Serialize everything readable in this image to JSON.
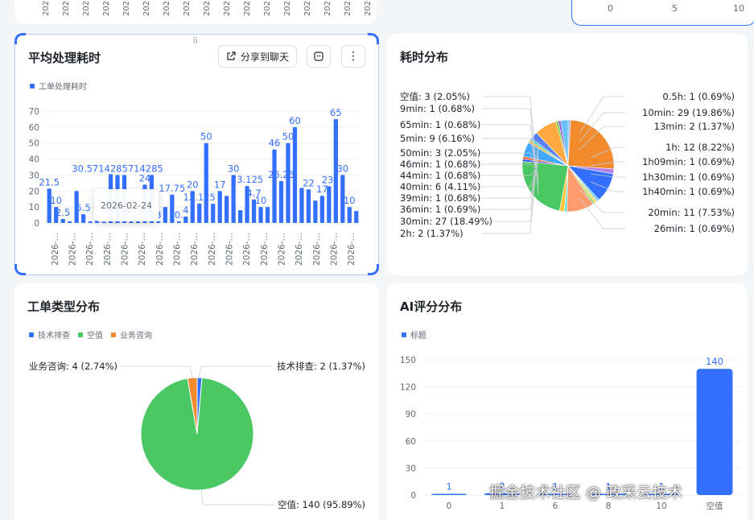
{
  "top_strip": {
    "ticks_right": [
      "0",
      "5",
      "10"
    ]
  },
  "avg_time": {
    "title": "平均处理耗时",
    "share_label": "分享到聊天",
    "tooltip": "2026-02-24",
    "chart_data": {
      "type": "bar",
      "series": [
        {
          "name": "工单处理耗时",
          "values": [
            21.5,
            10,
            2.5,
            1,
            20,
            5.5,
            1,
            1.5,
            0.8,
            30.5714285714285,
            30,
            30,
            1,
            1,
            24,
            30,
            1,
            10,
            17.75,
            1,
            4,
            20,
            12.125,
            50,
            12,
            20,
            17,
            30,
            8,
            23.125,
            14.7,
            10,
            10,
            46,
            26.25,
            50,
            60,
            22,
            21,
            14,
            17,
            23,
            65,
            30,
            10,
            7.5
          ]
        }
      ],
      "categories": [
        "2026-…",
        "2026-…",
        "2026-…",
        "2026-…",
        "2026-…",
        "2026-…",
        "2026-…",
        "2026-…",
        "2026-…",
        "2026-…",
        "2026-…",
        "2026-…",
        "2026-…",
        "2026-…",
        "2026-…",
        "2026-…",
        "2026-…",
        "2026-…"
      ],
      "data_labels": [
        {
          "i": 0,
          "text": "21.5"
        },
        {
          "i": 1,
          "text": "10"
        },
        {
          "i": 2,
          "text": "2.5"
        },
        {
          "i": 5,
          "text": "5.5"
        },
        {
          "i": 10,
          "text": "30.5714285714285"
        },
        {
          "i": 13,
          "text": "71428573"
        },
        {
          "i": 14,
          "text": "24"
        },
        {
          "i": 18,
          "text": "17.75"
        },
        {
          "i": 19,
          "text": "0."
        },
        {
          "i": 20,
          "text": "4"
        },
        {
          "i": 21,
          "text": "20"
        },
        {
          "i": 22,
          "text": "12.125"
        },
        {
          "i": 23,
          "text": "50"
        },
        {
          "i": 25,
          "text": "17"
        },
        {
          "i": 27,
          "text": "30"
        },
        {
          "i": 29,
          "text": "23.125"
        },
        {
          "i": 30,
          "text": "4.7"
        },
        {
          "i": 31,
          "text": "10"
        },
        {
          "i": 33,
          "text": "46"
        },
        {
          "i": 34,
          "text": "26.25"
        },
        {
          "i": 35,
          "text": "50"
        },
        {
          "i": 36,
          "text": "60"
        },
        {
          "i": 38,
          "text": "22"
        },
        {
          "i": 40,
          "text": "17"
        },
        {
          "i": 41,
          "text": "23."
        },
        {
          "i": 42,
          "text": "65"
        },
        {
          "i": 43,
          "text": "30"
        },
        {
          "i": 44,
          "text": "10"
        }
      ],
      "ylim": [
        0,
        70
      ],
      "yticks": [
        0,
        10,
        20,
        30,
        40,
        50,
        60,
        70
      ],
      "grid": true,
      "legend_position": "top-left",
      "color": "#3370ff"
    }
  },
  "time_dist": {
    "title": "耗时分布",
    "chart_data": {
      "type": "pie",
      "slices": [
        {
          "label": "0.5h: 1 (0.69%)",
          "value": 1,
          "color": "#8ab4f8"
        },
        {
          "label": "10min: 29 (19.86%)",
          "value": 29,
          "color": "#f28a2e"
        },
        {
          "label": "13min: 2 (1.37%)",
          "value": 2,
          "color": "#b37feb"
        },
        {
          "label": "1h: 12 (8.22%)",
          "value": 12,
          "color": "#3370ff"
        },
        {
          "label": "1h09min: 1 (0.69%)",
          "value": 1,
          "color": "#6dd3f0"
        },
        {
          "label": "1h30min: 1 (0.69%)",
          "value": 1,
          "color": "#ffd666"
        },
        {
          "label": "1h40min: 1 (0.69%)",
          "value": 1,
          "color": "#95de64"
        },
        {
          "label": "20min: 11 (7.53%)",
          "value": 11,
          "color": "#ff9c6e"
        },
        {
          "label": "26min: 1 (0.69%)",
          "value": 1,
          "color": "#5cdbd3"
        },
        {
          "label": "2h: 2 (1.37%)",
          "value": 2,
          "color": "#ffc53d"
        },
        {
          "label": "30min: 27 (18.49%)",
          "value": 27,
          "color": "#4ac864"
        },
        {
          "label": "36min: 1 (0.69%)",
          "value": 1,
          "color": "#2f54eb"
        },
        {
          "label": "39min: 1 (0.68%)",
          "value": 1,
          "color": "#fa541c"
        },
        {
          "label": "40min: 6 (4.11%)",
          "value": 6,
          "color": "#40a9ff"
        },
        {
          "label": "44min: 1 (0.68%)",
          "value": 1,
          "color": "#faad14"
        },
        {
          "label": "46min: 1 (0.68%)",
          "value": 1,
          "color": "#36cfc9"
        },
        {
          "label": "50min: 3 (2.05%)",
          "value": 3,
          "color": "#597ef7"
        },
        {
          "label": "5min: 9 (6.16%)",
          "value": 9,
          "color": "#ffa940"
        },
        {
          "label": "65min: 1 (0.68%)",
          "value": 1,
          "color": "#73d13d"
        },
        {
          "label": "9min: 1 (0.68%)",
          "value": 1,
          "color": "#9254de"
        },
        {
          "label": "空值: 3 (2.05%)",
          "value": 3,
          "color": "#69c0ff"
        }
      ],
      "legend": "outside-labels"
    }
  },
  "ticket_type": {
    "title": "工单类型分布",
    "chart_data": {
      "type": "pie",
      "legend_items": [
        {
          "name": "技术排查",
          "color": "#3370ff"
        },
        {
          "name": "空值",
          "color": "#4ac864"
        },
        {
          "name": "业务咨询",
          "color": "#f28a2e"
        }
      ],
      "slices": [
        {
          "label": "技术排查: 2 (1.37%)",
          "value": 2,
          "color": "#3370ff"
        },
        {
          "label": "空值: 140 (95.89%)",
          "value": 140,
          "color": "#4ac864"
        },
        {
          "label": "业务咨询: 4 (2.74%)",
          "value": 4,
          "color": "#f28a2e"
        }
      ],
      "legend_position": "top-left"
    }
  },
  "ai_score": {
    "title": "AI评分分布",
    "chart_data": {
      "type": "bar",
      "categories": [
        "0",
        "1",
        "6",
        "8",
        "10",
        "空值"
      ],
      "series": [
        {
          "name": "标题",
          "values": [
            1,
            2,
            1,
            1,
            1,
            140
          ]
        }
      ],
      "ylim": [
        0,
        150
      ],
      "yticks": [
        0,
        30,
        60,
        90,
        120,
        150
      ],
      "grid": true,
      "legend_position": "top-left",
      "color": "#3370ff"
    }
  },
  "watermark": "掘金技术社区 @ 政采云技术"
}
